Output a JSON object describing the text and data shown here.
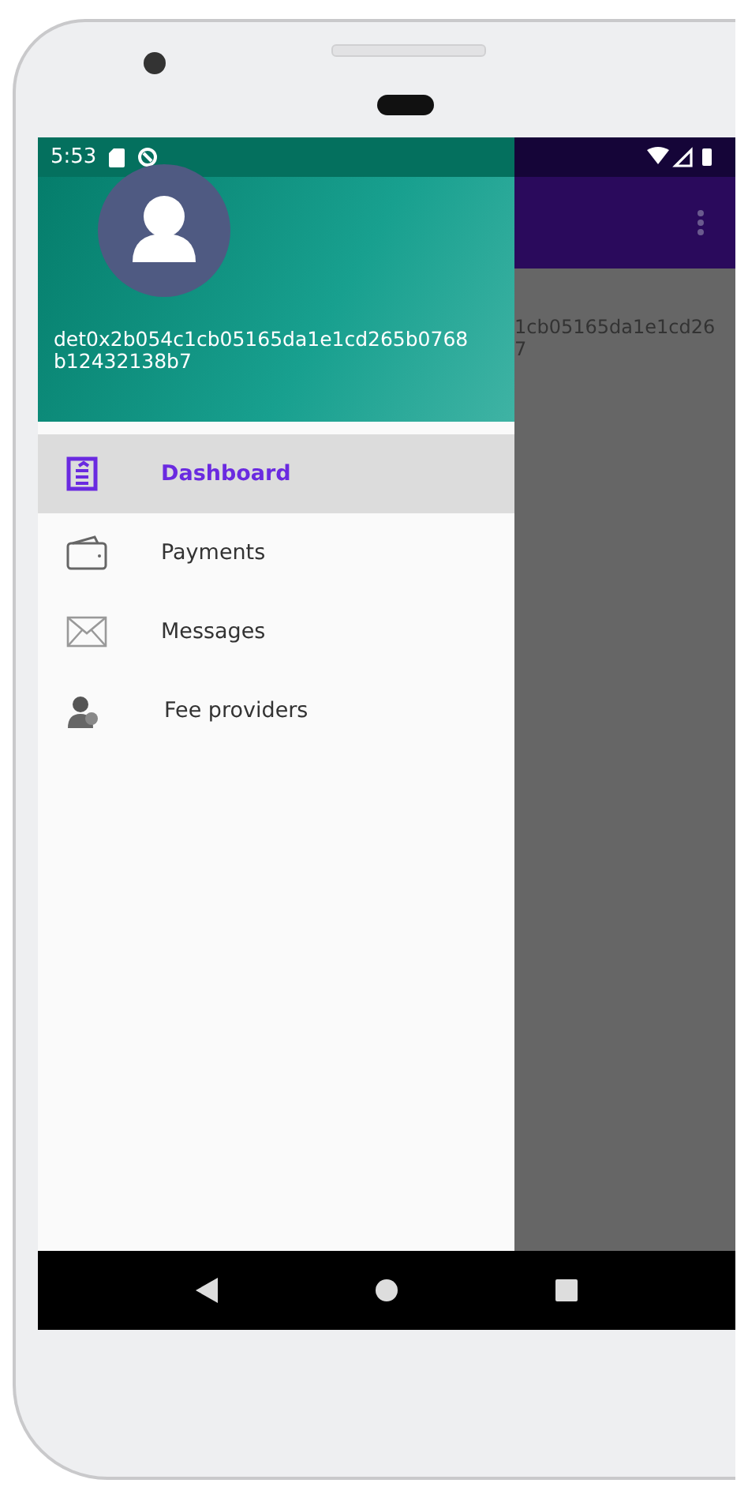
{
  "status_bar": {
    "time": "5:53"
  },
  "background_content": {
    "lines": [
      "1cb05165da1e1cd26",
      "7"
    ]
  },
  "drawer": {
    "header": {
      "account": "det0x2b054c1cb05165da1e1cd265b0768b12432138b7"
    },
    "items": [
      {
        "label": "Dashboard",
        "kind": "dashboard",
        "selected": true
      },
      {
        "label": "Payments",
        "kind": "wallet",
        "selected": false
      },
      {
        "label": "Messages",
        "kind": "mail",
        "selected": false
      },
      {
        "label": "Fee providers",
        "kind": "provider",
        "selected": false
      }
    ]
  }
}
